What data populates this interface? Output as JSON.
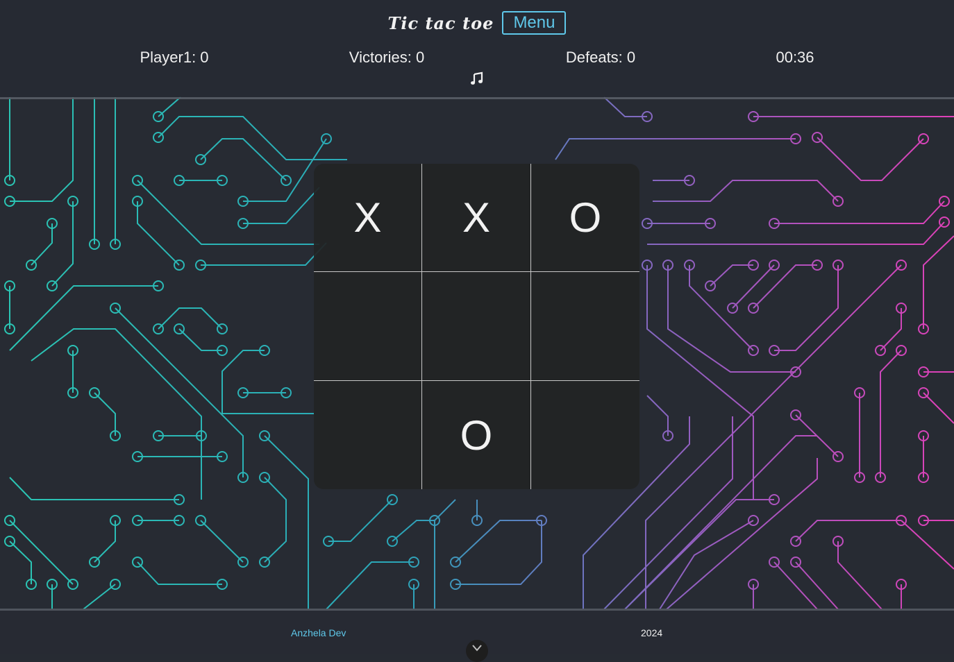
{
  "header": {
    "logo_text": "Tic tac toe",
    "menu_label": "Menu",
    "player": "Player1: 0",
    "victories": "Victories: 0",
    "defeats": "Defeats: 0",
    "timer": "00:36",
    "music_icon": "music-note-icon"
  },
  "board": {
    "cells": [
      "X",
      "X",
      "O",
      "",
      "",
      "",
      "",
      "O",
      ""
    ]
  },
  "footer": {
    "author": "Anzhela Dev",
    "year": "2024",
    "scroll_icon": "chevron-down-icon"
  },
  "colors": {
    "background": "#272b33",
    "accent": "#5fc8ea",
    "circuit_left": "#2bc6b4",
    "circuit_right": "#e040b8",
    "board": "#222325"
  }
}
